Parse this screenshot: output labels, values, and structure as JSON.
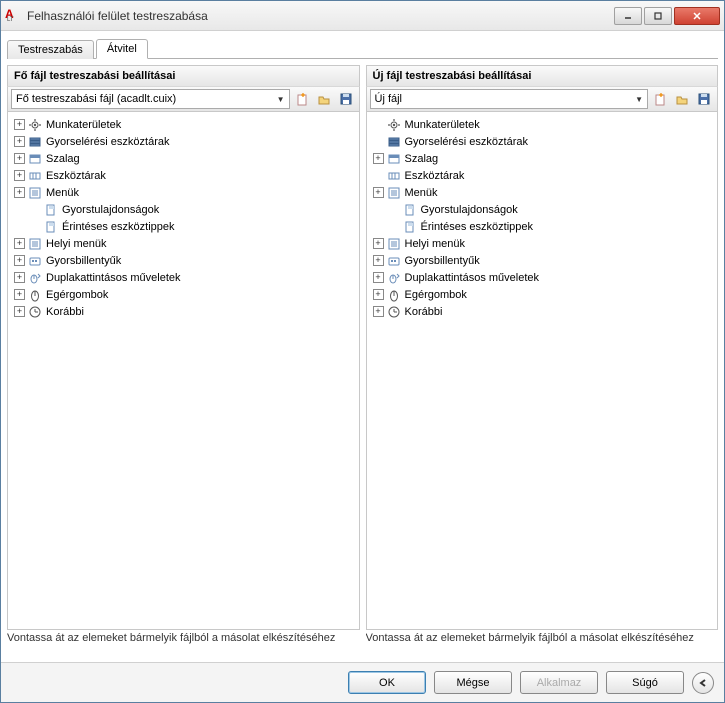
{
  "window": {
    "title": "Felhasználói felület testreszabása"
  },
  "tabs": {
    "customize": "Testreszabás",
    "transfer": "Átvitel"
  },
  "left": {
    "header": "Fő fájl testreszabási beállításai",
    "combo": "Fő testreszabási fájl (acadlt.cuix)",
    "tree": [
      {
        "label": "Munkaterületek",
        "exp": "plus",
        "icon": "gear"
      },
      {
        "label": "Gyorselérési eszköztárak",
        "exp": "plus",
        "icon": "stack"
      },
      {
        "label": "Szalag",
        "exp": "plus",
        "icon": "ribbon"
      },
      {
        "label": "Eszköztárak",
        "exp": "plus",
        "icon": "toolbar"
      },
      {
        "label": "Menük",
        "exp": "plus",
        "icon": "menu"
      },
      {
        "label": "Gyorstulajdonságok",
        "leaf": true,
        "icon": "leaf"
      },
      {
        "label": "Érintéses eszköztippek",
        "leaf": true,
        "icon": "leaf"
      },
      {
        "label": "Helyi menük",
        "exp": "plus",
        "icon": "menu"
      },
      {
        "label": "Gyorsbillentyűk",
        "exp": "plus",
        "icon": "key"
      },
      {
        "label": "Duplakattintásos műveletek",
        "exp": "plus",
        "icon": "dbl"
      },
      {
        "label": "Egérgombok",
        "exp": "plus",
        "icon": "mouse"
      },
      {
        "label": "Korábbi",
        "exp": "plus",
        "icon": "clock"
      }
    ],
    "footer": "Vontassa át az elemeket bármelyik fájlból a másolat elkészítéséhez"
  },
  "right": {
    "header": "Új fájl testreszabási beállításai",
    "combo": "Új fájl",
    "tree": [
      {
        "label": "Munkaterületek",
        "icon": "gear",
        "nochild": true
      },
      {
        "label": "Gyorselérési eszköztárak",
        "icon": "stack",
        "nochild": true
      },
      {
        "label": "Szalag",
        "exp": "plus",
        "icon": "ribbon"
      },
      {
        "label": "Eszköztárak",
        "icon": "toolbar",
        "nochild": true
      },
      {
        "label": "Menük",
        "exp": "plus",
        "icon": "menu"
      },
      {
        "label": "Gyorstulajdonságok",
        "leaf": true,
        "icon": "leaf"
      },
      {
        "label": "Érintéses eszköztippek",
        "leaf": true,
        "icon": "leaf"
      },
      {
        "label": "Helyi menük",
        "exp": "plus",
        "icon": "menu"
      },
      {
        "label": "Gyorsbillentyűk",
        "exp": "plus",
        "icon": "key"
      },
      {
        "label": "Duplakattintásos műveletek",
        "exp": "plus",
        "icon": "dbl"
      },
      {
        "label": "Egérgombok",
        "exp": "plus",
        "icon": "mouse"
      },
      {
        "label": "Korábbi",
        "exp": "plus",
        "icon": "clock"
      }
    ],
    "footer": "Vontassa át az elemeket bármelyik fájlból a másolat elkészítéséhez"
  },
  "buttons": {
    "ok": "OK",
    "cancel": "Mégse",
    "apply": "Alkalmaz",
    "help": "Súgó"
  }
}
